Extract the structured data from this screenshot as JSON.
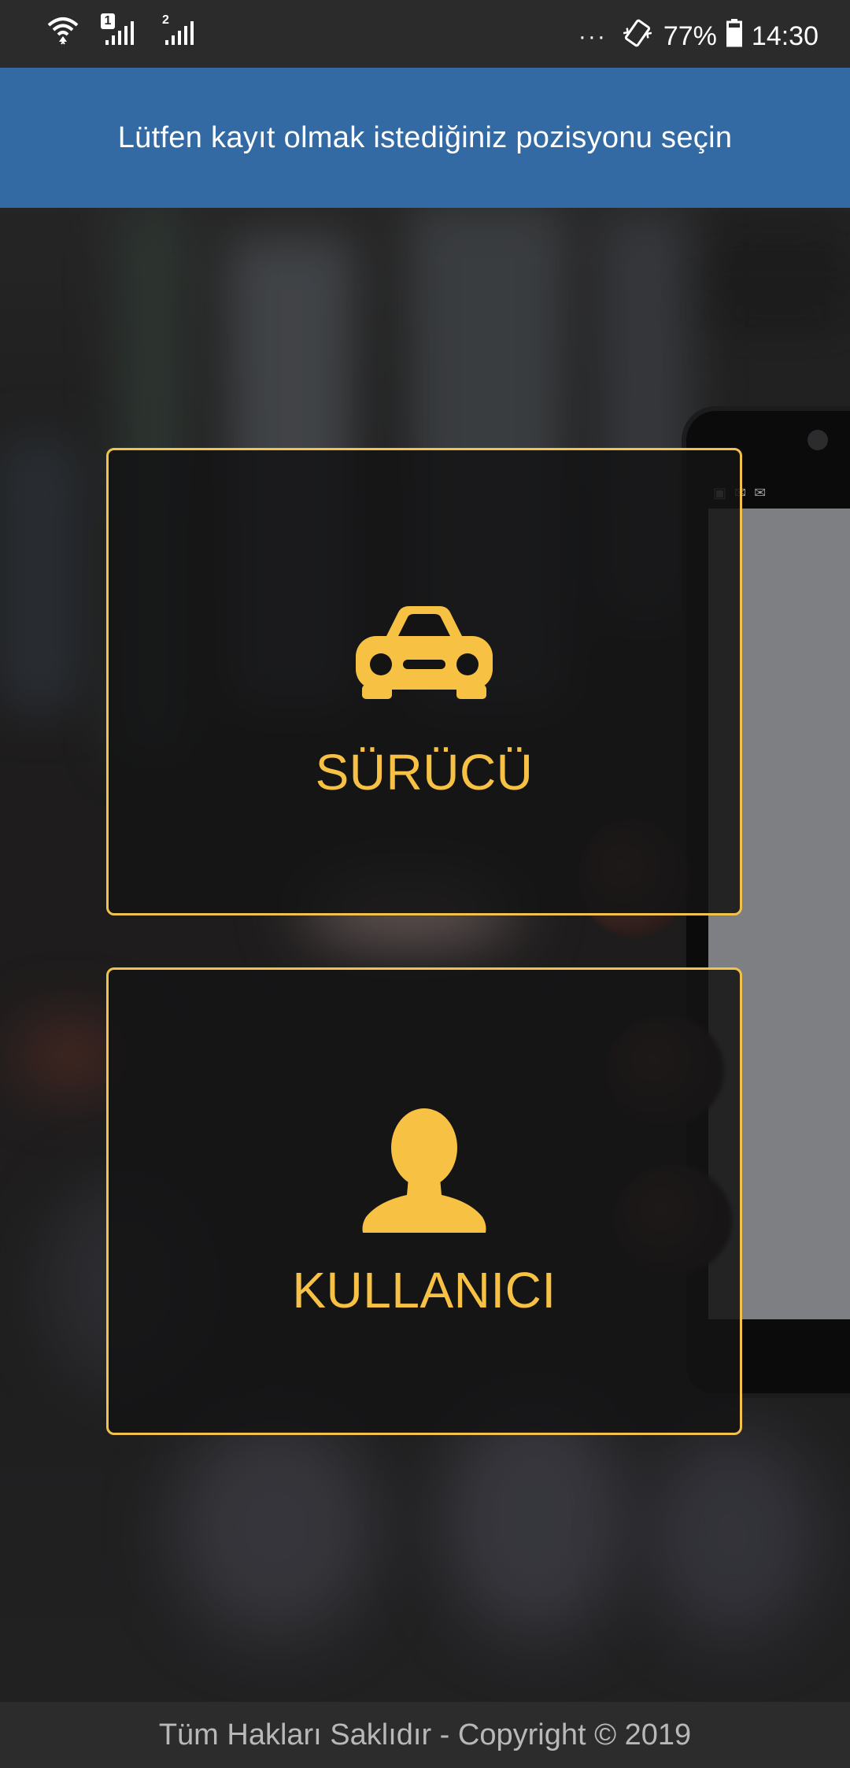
{
  "status_bar": {
    "sim1_badge": "1",
    "sim2_badge": "2",
    "overflow_indicator": "···",
    "battery_percent": "77%",
    "time": "14:30"
  },
  "header": {
    "title": "Lütfen kayıt olmak istediğiniz pozisyonu seçin",
    "background_color": "#346aa3"
  },
  "options": {
    "driver": {
      "label": "SÜRÜCÜ",
      "icon": "car-icon"
    },
    "user": {
      "label": "KULLANICI",
      "icon": "person-icon"
    }
  },
  "accent_color": "#f7c244",
  "footer": {
    "text": "Tüm Hakları Saklıdır - Copyright © 2019"
  }
}
